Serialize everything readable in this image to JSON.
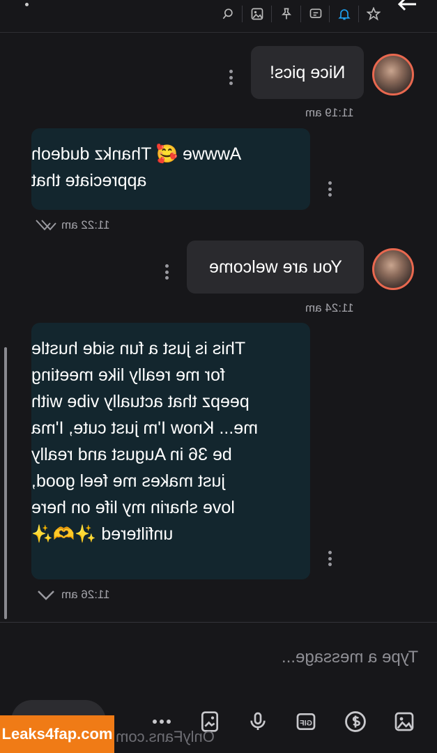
{
  "toolbar": {
    "icons": [
      "star-icon",
      "bell-icon",
      "message-icon",
      "pin-icon",
      "image-icon",
      "search-icon"
    ],
    "accent": "#1da1f2"
  },
  "messages": [
    {
      "direction": "out",
      "text": "Nice pics!",
      "time": "11:19 am"
    },
    {
      "direction": "in",
      "text_lines": [
        "Awwwe 🥰 Thankz dudeoh",
        "appreciate that"
      ],
      "time": "11:22 am"
    },
    {
      "direction": "out",
      "text": "You are welcome",
      "time": "11:24 am"
    },
    {
      "direction": "in",
      "text_lines": [
        "This is just a fun side hustle",
        "for me really like meeting",
        "peepz that actually vibe with",
        "me... Know I'm just cute, I'ma",
        "be 36 in August and really",
        "just makes me feel good,",
        "love sharin my life on here",
        "unfiltered ✨🫶✨"
      ],
      "time": "11:26 am"
    }
  ],
  "composer": {
    "placeholder": "Type a message...",
    "tools": [
      "image-icon",
      "dollar-icon",
      "gif-icon",
      "microphone-icon",
      "gallery-icon",
      "more-icon"
    ]
  },
  "watermark": {
    "badge": "Leaks4fap.com",
    "site": "OnlyFans.com"
  },
  "colors": {
    "background": "#17171a",
    "bubble_out": "#2a2a2e",
    "bubble_in": "#13262e",
    "avatar_ring": "#e9684f",
    "watermark": "#f07b16"
  }
}
